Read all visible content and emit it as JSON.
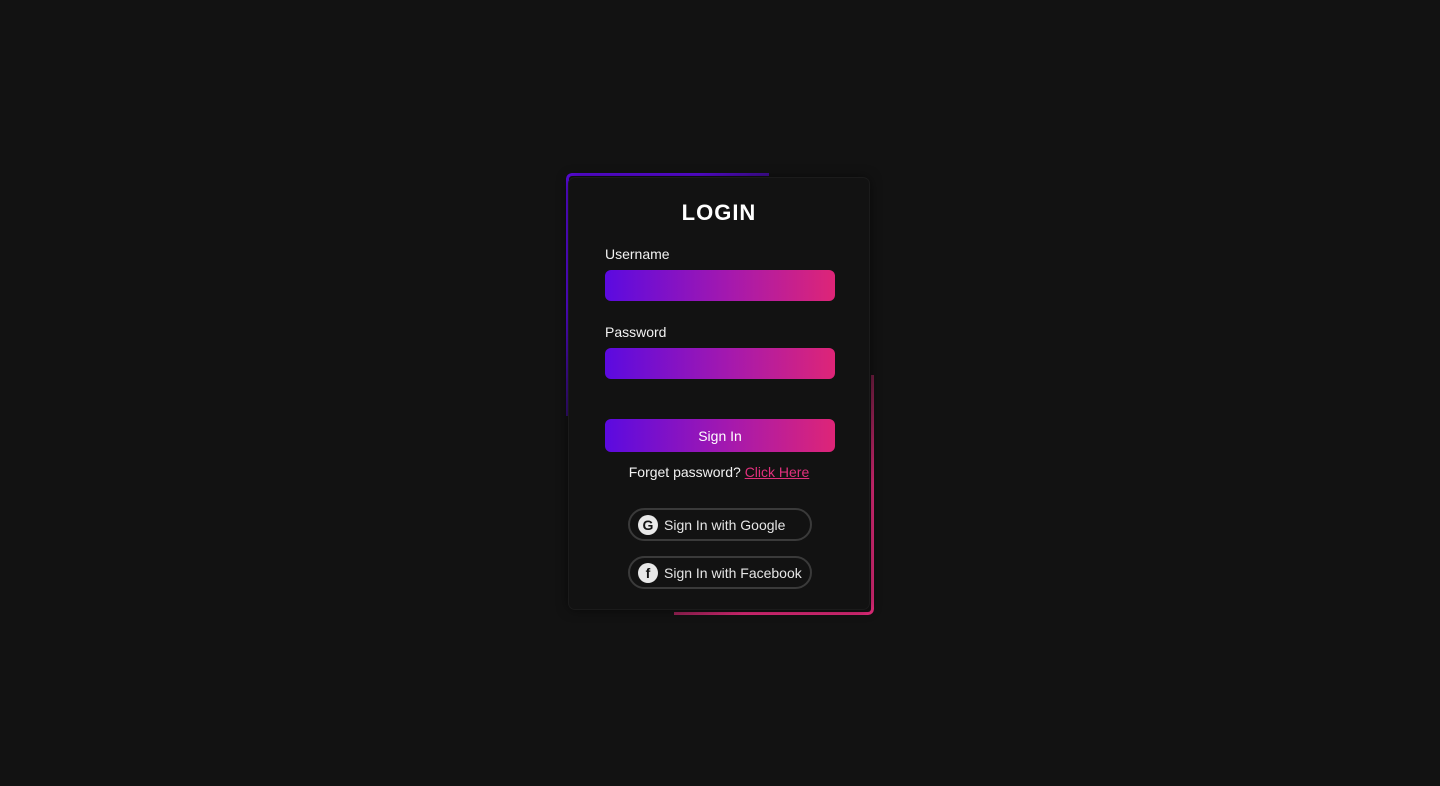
{
  "login": {
    "title": "LOGIN",
    "username_label": "Username",
    "password_label": "Password",
    "username_value": "",
    "password_value": "",
    "signin_label": "Sign In",
    "forget_text": "Forget password?",
    "forget_link": "Click Here",
    "google_label": "Sign In with Google",
    "facebook_label": "Sign In with Facebook",
    "google_icon": "google-icon",
    "facebook_icon": "facebook-icon"
  },
  "colors": {
    "background": "#121212",
    "gradient_start": "#5b0ae0",
    "gradient_end": "#de2577",
    "link": "#e0307c"
  }
}
